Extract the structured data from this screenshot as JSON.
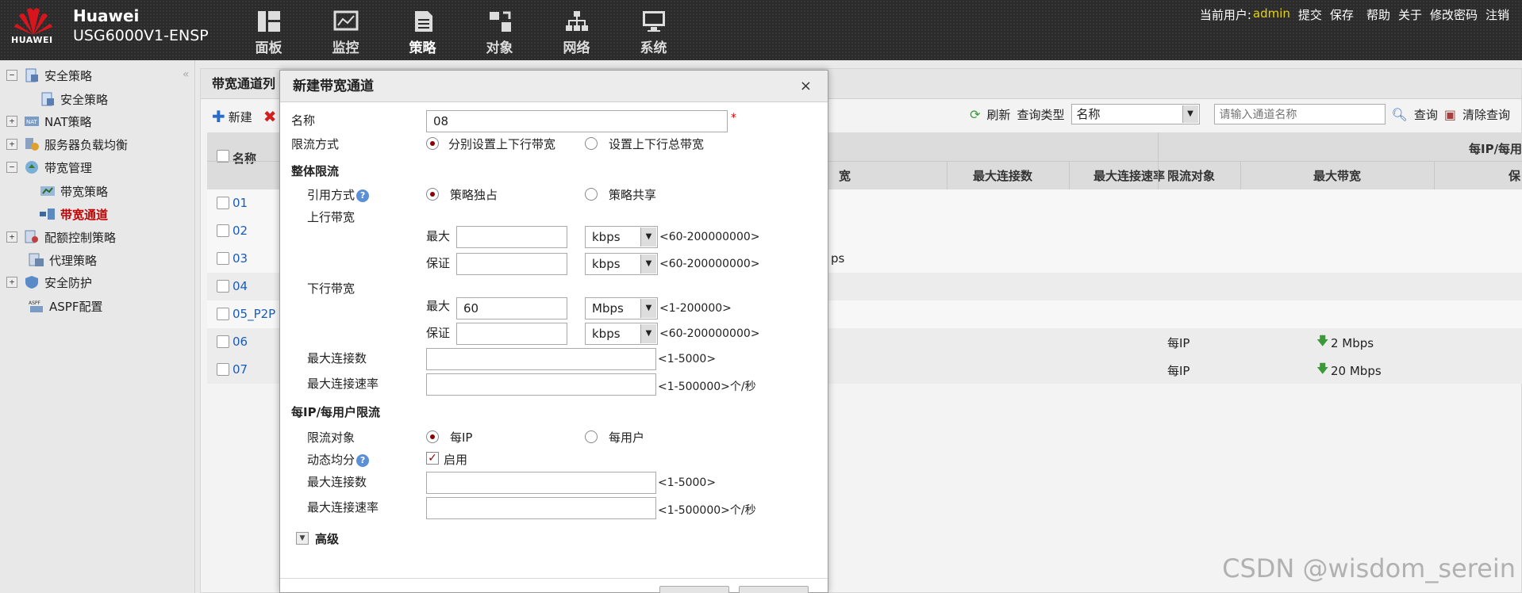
{
  "header": {
    "brand": "Huawei",
    "model": "USG6000V1-ENSP",
    "logo_text": "HUAWEI",
    "nav": [
      {
        "label": "面板",
        "icon": "dashboard-icon"
      },
      {
        "label": "监控",
        "icon": "monitor-icon"
      },
      {
        "label": "策略",
        "icon": "policy-icon"
      },
      {
        "label": "对象",
        "icon": "object-icon"
      },
      {
        "label": "网络",
        "icon": "network-icon"
      },
      {
        "label": "系统",
        "icon": "system-icon"
      }
    ],
    "user_label": "当前用户:",
    "username": "admin",
    "links": [
      "提交",
      "保存",
      "帮助",
      "关于",
      "修改密码",
      "注销"
    ]
  },
  "sidebar": {
    "items": [
      {
        "label": "安全策略",
        "expander": "−"
      },
      {
        "label": "安全策略",
        "expander": ""
      },
      {
        "label": "NAT策略",
        "expander": "+"
      },
      {
        "label": "服务器负载均衡",
        "expander": "+"
      },
      {
        "label": "带宽管理",
        "expander": "−"
      },
      {
        "label": "带宽策略",
        "expander": ""
      },
      {
        "label": "带宽通道",
        "expander": ""
      },
      {
        "label": "配额控制策略",
        "expander": "+"
      },
      {
        "label": "代理策略",
        "expander": ""
      },
      {
        "label": "安全防护",
        "expander": "+"
      },
      {
        "label": "ASPF配置",
        "expander": ""
      }
    ]
  },
  "main": {
    "title": "带宽通道列",
    "new_label": "新建",
    "refresh_label": "刷新",
    "query_type_label": "查询类型",
    "query_type_value": "名称",
    "search_placeholder": "请输入通道名称",
    "query_label": "查询",
    "clear_label": "清除查询",
    "columns": {
      "name": "名称",
      "col_partial": "宽",
      "max_conn": "最大连接数",
      "max_conn_rate": "最大连接速率",
      "limit_obj": "限流对象",
      "max_bw": "最大带宽",
      "per_ip_group": "每IP/每用",
      "extra": "保"
    },
    "rows": [
      {
        "name": "01",
        "partial": "",
        "obj": "",
        "bw": ""
      },
      {
        "name": "02",
        "partial": "",
        "obj": "",
        "bw": ""
      },
      {
        "name": "03",
        "partial": "ps",
        "obj": "",
        "bw": ""
      },
      {
        "name": "04",
        "partial": "",
        "obj": "",
        "bw": ""
      },
      {
        "name": "05_P2P",
        "partial": "",
        "obj": "",
        "bw": ""
      },
      {
        "name": "06",
        "partial": "",
        "obj": "每IP",
        "bw": "2 Mbps"
      },
      {
        "name": "07",
        "partial": "",
        "obj": "每IP",
        "bw": "20 Mbps"
      }
    ]
  },
  "dialog": {
    "title": "新建带宽通道",
    "close": "×",
    "name_label": "名称",
    "name_value": "08",
    "required_mark": "*",
    "limit_mode_label": "限流方式",
    "limit_mode_opt1": "分别设置上下行带宽",
    "limit_mode_opt2": "设置上下行总带宽",
    "overall_section": "整体限流",
    "ref_mode_label": "引用方式",
    "ref_opt1": "策略独占",
    "ref_opt2": "策略共享",
    "up_bw_label": "上行带宽",
    "max_label": "最大",
    "guarantee_label": "保证",
    "up_max_value": "",
    "up_max_unit": "kbps",
    "up_max_hint": "<60-200000000>",
    "up_guar_value": "",
    "up_guar_unit": "kbps",
    "up_guar_hint": "<60-200000000>",
    "down_bw_label": "下行带宽",
    "down_max_value": "60",
    "down_max_unit": "Mbps",
    "down_max_hint": "<1-200000>",
    "down_guar_value": "",
    "down_guar_unit": "kbps",
    "down_guar_hint": "<60-200000000>",
    "max_conn_label": "最大连接数",
    "max_conn_hint": "<1-5000>",
    "max_conn_rate_label": "最大连接速率",
    "max_conn_rate_hint": "<1-500000>个/秒",
    "per_ip_section": "每IP/每用户限流",
    "limit_obj_label": "限流对象",
    "obj_opt1": "每IP",
    "obj_opt2": "每用户",
    "dynamic_label": "动态均分",
    "enable_label": "启用",
    "ip_max_conn_label": "最大连接数",
    "ip_max_conn_hint": "<1-5000>",
    "ip_max_conn_rate_label": "最大连接速率",
    "ip_max_conn_rate_hint": "<1-500000>个/秒",
    "advanced_label": "高级",
    "help": "?"
  },
  "watermark": "CSDN @wisdom_serein"
}
